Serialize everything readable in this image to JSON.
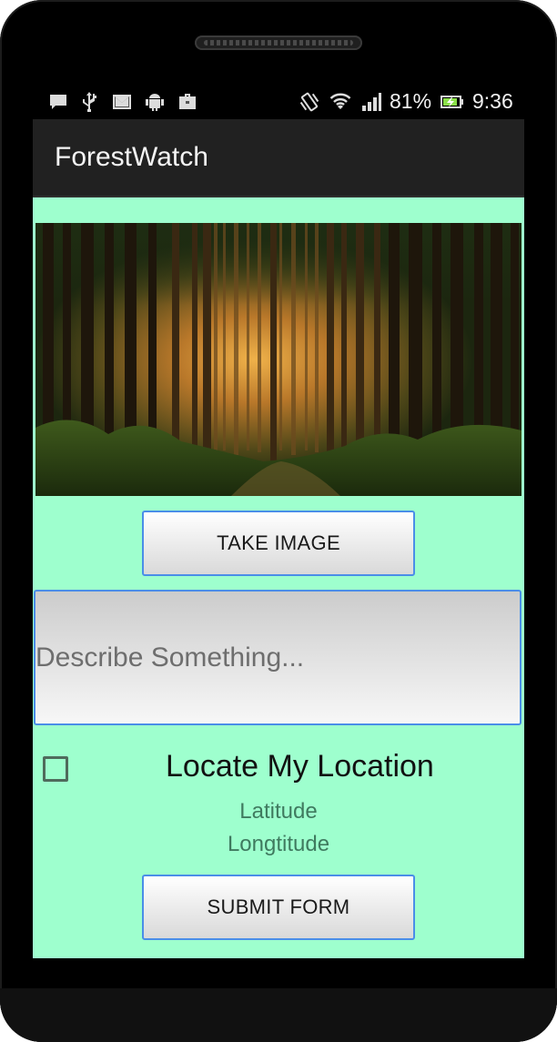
{
  "status_bar": {
    "battery_percent": "81%",
    "time": "9:36",
    "icons": [
      "chat-icon",
      "usb-icon",
      "gmail-icon",
      "android-debug-icon",
      "briefcase-icon",
      "vibrate-icon",
      "wifi-icon",
      "signal-icon",
      "battery-charging-icon"
    ]
  },
  "action_bar": {
    "title": "ForestWatch"
  },
  "main": {
    "image": {
      "description_icon": "forest-photo"
    },
    "take_image_label": "TAKE IMAGE",
    "description_placeholder": "Describe Something...",
    "description_value": "",
    "locate": {
      "label": "Locate My Location",
      "checked": false
    },
    "latitude_label": "Latitude",
    "longitude_label": "Longtitude",
    "submit_label": "SUBMIT FORM"
  },
  "colors": {
    "content_background": "#9effce",
    "action_bar": "#212121",
    "button_border": "#4a8ee8",
    "coord_text": "#3f7a5f"
  }
}
